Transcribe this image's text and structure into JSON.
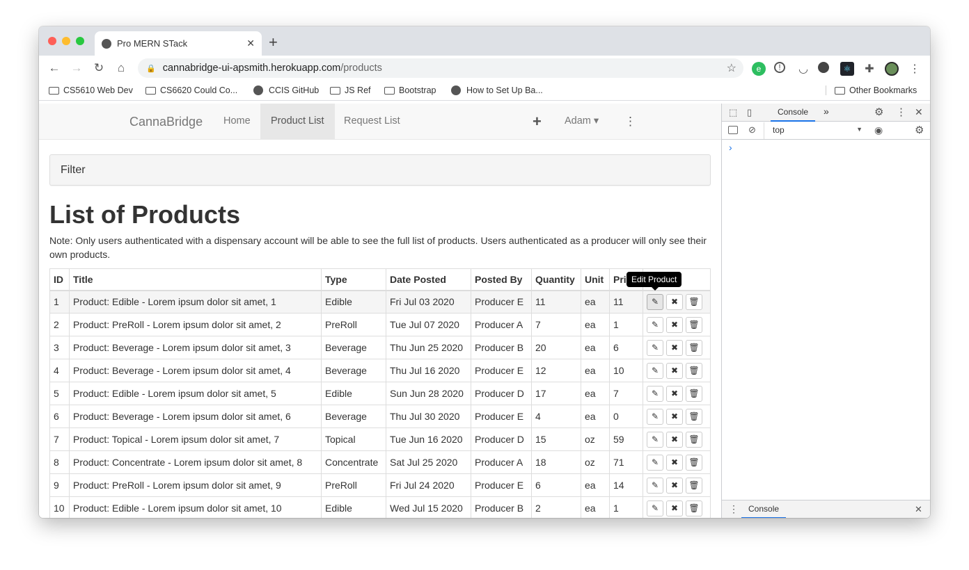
{
  "browser": {
    "tab_title": "Pro MERN STack",
    "tab_close": "✕",
    "new_tab": "+",
    "url_host": "cannabridge-ui-apsmith.herokuapp.com",
    "url_path": "/products",
    "bookmarks": [
      "CS5610 Web Dev",
      "CS6620 Could Co...",
      "CCIS GitHub",
      "JS Ref",
      "Bootstrap",
      "How to Set Up Ba..."
    ],
    "other_bookmarks": "Other Bookmarks"
  },
  "navbar": {
    "brand": "CannaBridge",
    "home": "Home",
    "product_list": "Product List",
    "request_list": "Request List",
    "add": "+",
    "user": "Adam ▾",
    "more": "⋮"
  },
  "filter": {
    "label": "Filter"
  },
  "page": {
    "title": "List of Products",
    "note": "Note: Only users authenticated with a dispensary account will be able to see the full list of products. Users authenticated as a producer will only see their own products."
  },
  "table": {
    "headers": [
      "ID",
      "Title",
      "Type",
      "Date Posted",
      "Posted By",
      "Quantity",
      "Unit",
      "Pri",
      ""
    ],
    "rows": [
      [
        "1",
        "Product: Edible - Lorem ipsum dolor sit amet, 1",
        "Edible",
        "Fri Jul 03 2020",
        "Producer E",
        "11",
        "ea",
        "11"
      ],
      [
        "2",
        "Product: PreRoll - Lorem ipsum dolor sit amet, 2",
        "PreRoll",
        "Tue Jul 07 2020",
        "Producer A",
        "7",
        "ea",
        "1"
      ],
      [
        "3",
        "Product: Beverage - Lorem ipsum dolor sit amet, 3",
        "Beverage",
        "Thu Jun 25 2020",
        "Producer B",
        "20",
        "ea",
        "6"
      ],
      [
        "4",
        "Product: Beverage - Lorem ipsum dolor sit amet, 4",
        "Beverage",
        "Thu Jul 16 2020",
        "Producer E",
        "12",
        "ea",
        "10"
      ],
      [
        "5",
        "Product: Edible - Lorem ipsum dolor sit amet, 5",
        "Edible",
        "Sun Jun 28 2020",
        "Producer D",
        "17",
        "ea",
        "7"
      ],
      [
        "6",
        "Product: Beverage - Lorem ipsum dolor sit amet, 6",
        "Beverage",
        "Thu Jul 30 2020",
        "Producer E",
        "4",
        "ea",
        "0"
      ],
      [
        "7",
        "Product: Topical - Lorem ipsum dolor sit amet, 7",
        "Topical",
        "Tue Jun 16 2020",
        "Producer D",
        "15",
        "oz",
        "59"
      ],
      [
        "8",
        "Product: Concentrate - Lorem ipsum dolor sit amet, 8",
        "Concentrate",
        "Sat Jul 25 2020",
        "Producer A",
        "18",
        "oz",
        "71"
      ],
      [
        "9",
        "Product: PreRoll - Lorem ipsum dolor sit amet, 9",
        "PreRoll",
        "Fri Jul 24 2020",
        "Producer E",
        "6",
        "ea",
        "14"
      ],
      [
        "10",
        "Product: Edible - Lorem ipsum dolor sit amet, 10",
        "Edible",
        "Wed Jul 15 2020",
        "Producer B",
        "2",
        "ea",
        "1"
      ]
    ],
    "action_icons": [
      "edit-icon",
      "close-icon",
      "trash-icon"
    ]
  },
  "tooltip": {
    "text": "Edit Product"
  },
  "devtools": {
    "tab_console": "Console",
    "more_tabs": "»",
    "context": "top",
    "prompt": "›",
    "drawer_tab": "Console"
  },
  "colors": {
    "accent_blue": "#1a73e8",
    "navbar_bg": "#f8f8f8",
    "tooltip_bg": "#000000"
  }
}
